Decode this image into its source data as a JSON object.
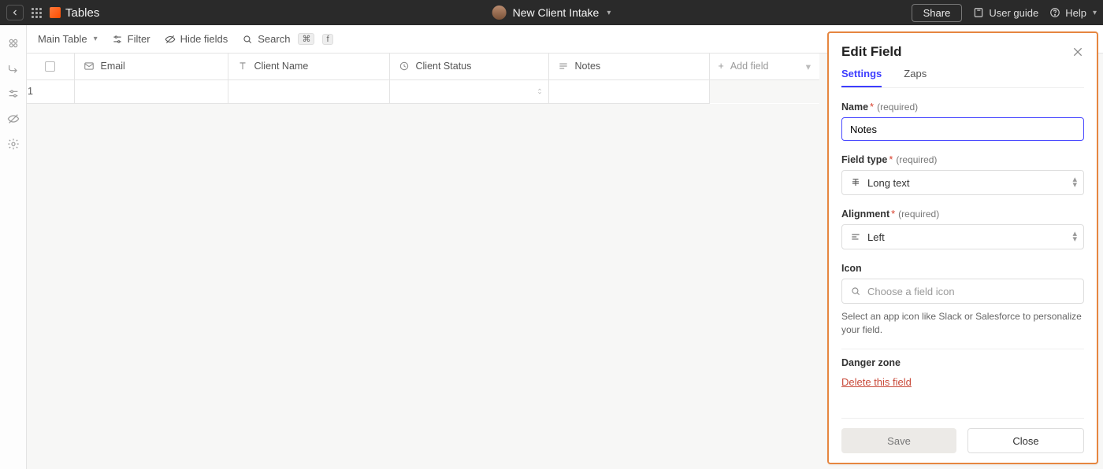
{
  "topbar": {
    "app_title": "Tables",
    "doc_title": "New Client Intake",
    "share": "Share",
    "user_guide": "User guide",
    "help": "Help"
  },
  "toolbar": {
    "view_name": "Main Table",
    "filter": "Filter",
    "hide_fields": "Hide fields",
    "search": "Search",
    "search_shortcut_1": "⌘",
    "search_shortcut_2": "f"
  },
  "columns": {
    "email": "Email",
    "client_name": "Client Name",
    "client_status": "Client Status",
    "notes": "Notes",
    "add_field": "Add field"
  },
  "rows": [
    {
      "idx": "1",
      "email": "",
      "client_name": "",
      "client_status": "",
      "notes": ""
    }
  ],
  "panel": {
    "title": "Edit Field",
    "tabs": {
      "settings": "Settings",
      "zaps": "Zaps"
    },
    "name_label": "Name",
    "name_value": "Notes",
    "fieldtype_label": "Field type",
    "fieldtype_value": "Long text",
    "align_label": "Alignment",
    "align_value": "Left",
    "icon_label": "Icon",
    "icon_placeholder": "Choose a field icon",
    "icon_help": "Select an app icon like Slack or Salesforce to personalize your field.",
    "danger_title": "Danger zone",
    "delete_label": "Delete this field",
    "save": "Save",
    "close": "Close",
    "required_word": "(required)"
  }
}
